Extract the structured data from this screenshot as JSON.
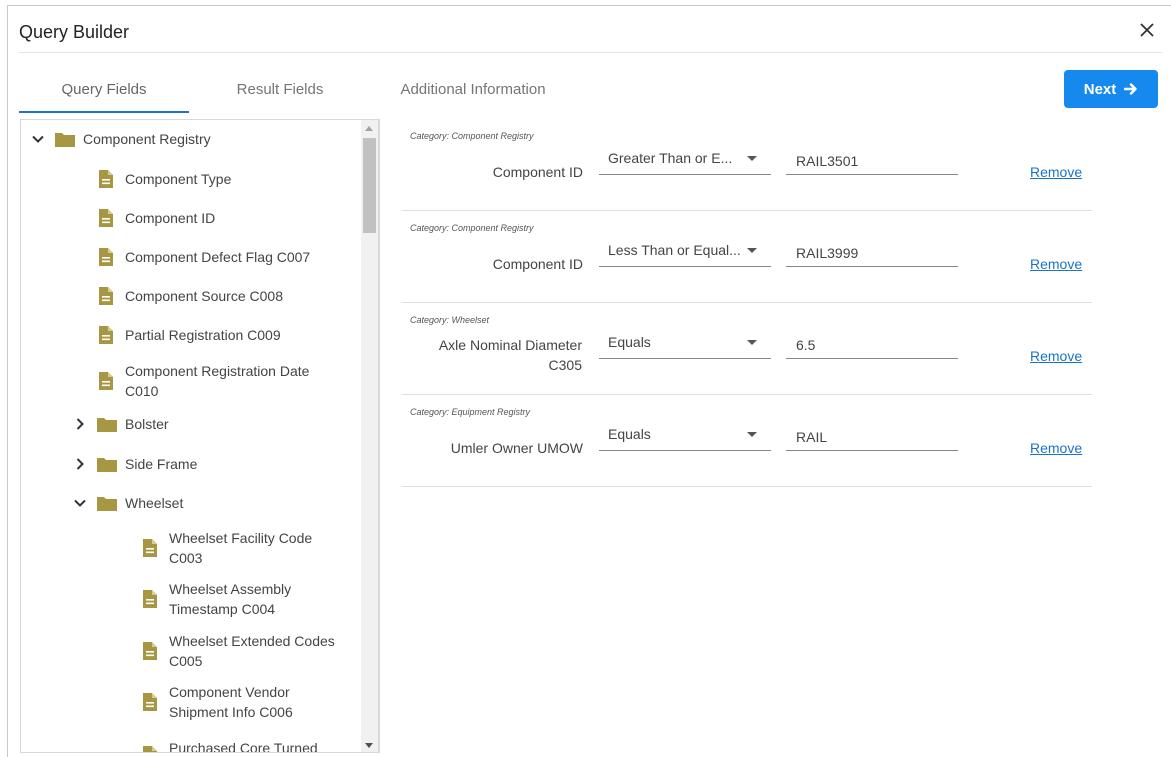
{
  "dialog": {
    "title": "Query Builder"
  },
  "tabs": [
    {
      "label": "Query Fields",
      "active": true
    },
    {
      "label": "Result Fields",
      "active": false
    },
    {
      "label": "Additional Information",
      "active": false
    }
  ],
  "next_button": {
    "label": "Next"
  },
  "colors": {
    "accent": "#1589ee",
    "folder": "#a89742",
    "link": "#1a73c9"
  },
  "tree": {
    "root": {
      "label": "Component Registry",
      "expanded": true
    },
    "root_children": [
      "Component Type",
      "Component ID",
      "Component Defect Flag C007",
      "Component Source C008",
      "Partial Registration C009",
      "Component Registration Date C010"
    ],
    "folders": [
      {
        "label": "Bolster",
        "expanded": false
      },
      {
        "label": "Side Frame",
        "expanded": false
      },
      {
        "label": "Wheelset",
        "expanded": true
      }
    ],
    "wheelset_children": [
      "Wheelset Facility Code C003",
      "Wheelset Assembly Timestamp C004",
      "Wheelset Extended Codes C005",
      "Component Vendor Shipment Info C006",
      "Purchased Core Turned"
    ]
  },
  "criteria": [
    {
      "category": "Category: Component Registry",
      "field": "Component ID",
      "operator": "Greater Than or E...",
      "value": "RAIL3501",
      "remove_label": "Remove"
    },
    {
      "category": "Category: Component Registry",
      "field": "Component ID",
      "operator": "Less Than or Equal...",
      "value": "RAIL3999",
      "remove_label": "Remove"
    },
    {
      "category": "Category: Wheelset",
      "field": "Axle Nominal Diameter C305",
      "operator": "Equals",
      "value": "6.5",
      "remove_label": "Remove"
    },
    {
      "category": "Category: Equipment Registry",
      "field": "Umler Owner UMOW",
      "operator": "Equals",
      "value": "RAIL",
      "remove_label": "Remove"
    }
  ]
}
